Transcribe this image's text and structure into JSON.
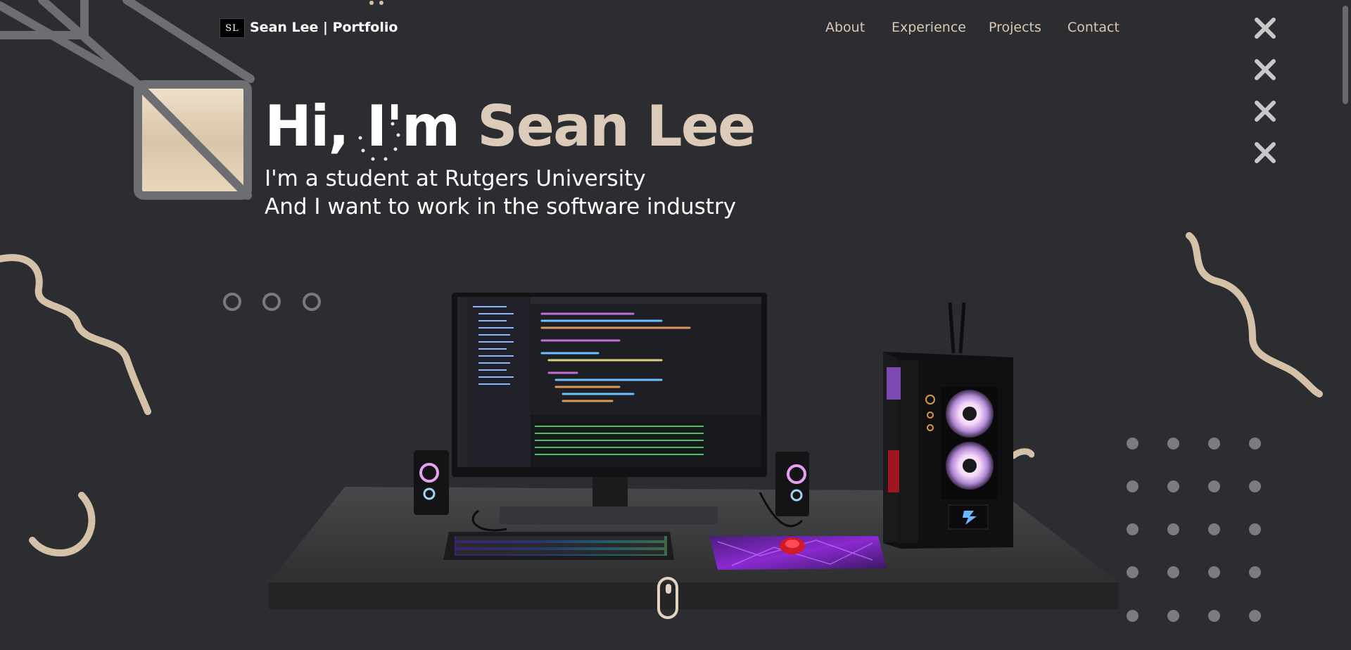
{
  "nav": {
    "logo_text": "SL",
    "brand": "Sean Lee | Portfolio",
    "links": [
      "About",
      "Experience",
      "Projects",
      "Contact"
    ]
  },
  "hero": {
    "greeting": "Hi, I'm ",
    "name": "Sean Lee",
    "line1": "I'm a student at Rutgers University",
    "line2": "And I want to work in the software industry"
  },
  "icons": {
    "close": "close-icon",
    "scroll": "scroll-down-icon"
  },
  "colors": {
    "background": "#2b2d30",
    "accent": "#dccbb8",
    "nav_link": "#d8c8b4",
    "decoration": "#7a7a7c"
  }
}
